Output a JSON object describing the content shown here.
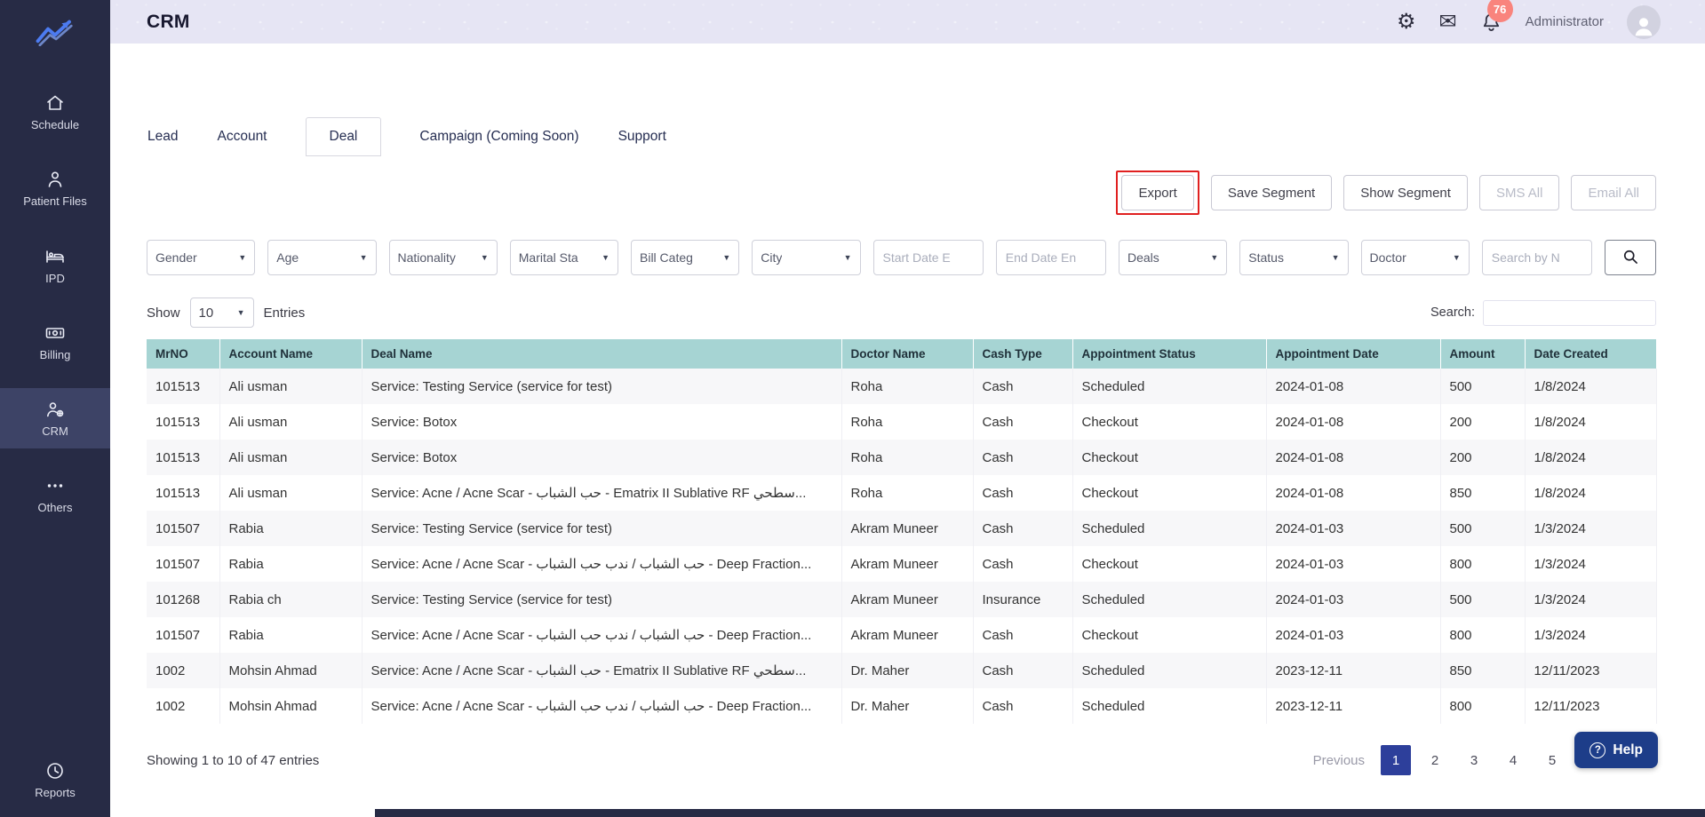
{
  "header": {
    "title": "CRM",
    "user": "Administrator",
    "notification_count": "76"
  },
  "icons": {
    "settings_glyph": "⚙",
    "mail_glyph": "✉",
    "caret": "▼"
  },
  "sidebar": {
    "items": [
      {
        "id": "schedule",
        "label": "Schedule"
      },
      {
        "id": "patient-files",
        "label": "Patient Files"
      },
      {
        "id": "ipd",
        "label": "IPD"
      },
      {
        "id": "billing",
        "label": "Billing"
      },
      {
        "id": "crm",
        "label": "CRM",
        "active": true
      },
      {
        "id": "others",
        "label": "Others"
      },
      {
        "id": "reports",
        "label": "Reports"
      }
    ]
  },
  "tabs": [
    {
      "id": "lead",
      "label": "Lead"
    },
    {
      "id": "account",
      "label": "Account"
    },
    {
      "id": "deal",
      "label": "Deal",
      "active": true
    },
    {
      "id": "campaign",
      "label": "Campaign (Coming Soon)"
    },
    {
      "id": "support",
      "label": "Support"
    }
  ],
  "actions": {
    "export": "Export",
    "save_segment": "Save Segment",
    "show_segment": "Show Segment",
    "sms_all": "SMS All",
    "email_all": "Email All"
  },
  "filters": {
    "gender": "Gender",
    "age": "Age",
    "nationality": "Nationality",
    "marital_status": "Marital Sta",
    "bill_category": "Bill Categ",
    "city": "City",
    "start_date_placeholder": "Start Date E",
    "end_date_placeholder": "End Date En",
    "deals": "Deals",
    "status": "Status",
    "doctor": "Doctor",
    "search_placeholder": "Search by N"
  },
  "list_controls": {
    "show_label": "Show",
    "page_size": "10",
    "entries_label": "Entries",
    "search_label": "Search:"
  },
  "table": {
    "headers": [
      "MrNO",
      "Account Name",
      "Deal Name",
      "Doctor Name",
      "Cash Type",
      "Appointment Status",
      "Appointment Date",
      "Amount",
      "Date Created"
    ],
    "rows": [
      {
        "mrno": "101513",
        "account": "Ali usman",
        "deal": "Service: Testing Service (service for test)",
        "doctor": "Roha",
        "cash_type": "Cash",
        "appointment_status": "Scheduled",
        "appointment_date": "2024-01-08",
        "amount": "500",
        "date_created": "1/8/2024"
      },
      {
        "mrno": "101513",
        "account": "Ali usman",
        "deal": "Service: Botox",
        "doctor": "Roha",
        "cash_type": "Cash",
        "appointment_status": "Checkout",
        "appointment_date": "2024-01-08",
        "amount": "200",
        "date_created": "1/8/2024"
      },
      {
        "mrno": "101513",
        "account": "Ali usman",
        "deal": "Service: Botox",
        "doctor": "Roha",
        "cash_type": "Cash",
        "appointment_status": "Checkout",
        "appointment_date": "2024-01-08",
        "amount": "200",
        "date_created": "1/8/2024"
      },
      {
        "mrno": "101513",
        "account": "Ali usman",
        "deal": "Service: Acne / Acne Scar - حب الشباب - Ematrix II Sublative RF سطحي...",
        "doctor": "Roha",
        "cash_type": "Cash",
        "appointment_status": "Checkout",
        "appointment_date": "2024-01-08",
        "amount": "850",
        "date_created": "1/8/2024"
      },
      {
        "mrno": "101507",
        "account": "Rabia",
        "deal": "Service: Testing Service (service for test)",
        "doctor": "Akram Muneer",
        "cash_type": "Cash",
        "appointment_status": "Scheduled",
        "appointment_date": "2024-01-03",
        "amount": "500",
        "date_created": "1/3/2024"
      },
      {
        "mrno": "101507",
        "account": "Rabia",
        "deal": "Service: Acne / Acne Scar - حب الشباب / ندب حب الشباب - Deep Fraction...",
        "doctor": "Akram Muneer",
        "cash_type": "Cash",
        "appointment_status": "Checkout",
        "appointment_date": "2024-01-03",
        "amount": "800",
        "date_created": "1/3/2024"
      },
      {
        "mrno": "101268",
        "account": "Rabia ch",
        "deal": "Service: Testing Service (service for test)",
        "doctor": "Akram Muneer",
        "cash_type": "Insurance",
        "appointment_status": "Scheduled",
        "appointment_date": "2024-01-03",
        "amount": "500",
        "date_created": "1/3/2024"
      },
      {
        "mrno": "101507",
        "account": "Rabia",
        "deal": "Service: Acne / Acne Scar - حب الشباب / ندب حب الشباب - Deep Fraction...",
        "doctor": "Akram Muneer",
        "cash_type": "Cash",
        "appointment_status": "Checkout",
        "appointment_date": "2024-01-03",
        "amount": "800",
        "date_created": "1/3/2024"
      },
      {
        "mrno": "1002",
        "account": "Mohsin Ahmad",
        "deal": "Service: Acne / Acne Scar - حب الشباب - Ematrix II Sublative RF سطحي...",
        "doctor": "Dr. Maher",
        "cash_type": "Cash",
        "appointment_status": "Scheduled",
        "appointment_date": "2023-12-11",
        "amount": "850",
        "date_created": "12/11/2023"
      },
      {
        "mrno": "1002",
        "account": "Mohsin Ahmad",
        "deal": "Service: Acne / Acne Scar - حب الشباب / ندب حب الشباب - Deep Fraction...",
        "doctor": "Dr. Maher",
        "cash_type": "Cash",
        "appointment_status": "Scheduled",
        "appointment_date": "2023-12-11",
        "amount": "800",
        "date_created": "12/11/2023"
      }
    ]
  },
  "footer": {
    "summary": "Showing 1 to 10 of 47 entries",
    "previous_label": "Previous",
    "pages": [
      {
        "id": "1",
        "label": "1",
        "active": true
      },
      {
        "id": "2",
        "label": "2"
      },
      {
        "id": "3",
        "label": "3"
      },
      {
        "id": "4",
        "label": "4"
      },
      {
        "id": "5",
        "label": "5"
      }
    ],
    "help_label": "Help"
  },
  "colors": {
    "sidebar_bg": "#272b45",
    "sidebar_active_bg": "#3d4366",
    "header_bg": "#e6e5f4",
    "table_header_bg": "#a6d4d3",
    "page_active_bg": "#2d3f9b",
    "help_bg": "#1d3d89",
    "badge_bg": "#f9847d",
    "export_outline": "#e02020"
  }
}
